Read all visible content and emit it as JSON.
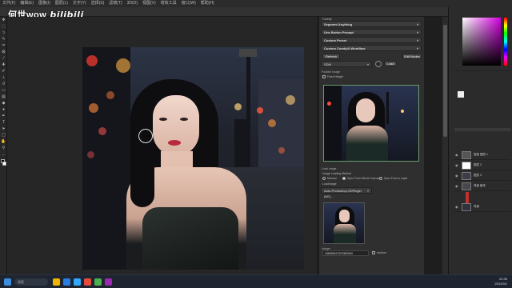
{
  "watermark": {
    "channel": "何世wow",
    "logo": "bilibili"
  },
  "menu": [
    "文件(F)",
    "编辑(E)",
    "图像(I)",
    "图层(L)",
    "文字(Y)",
    "选择(S)",
    "滤镜(T)",
    "3D(D)",
    "视图(V)",
    "增效工具",
    "窗口(W)",
    "帮助(H)"
  ],
  "panel": {
    "title": "Comfy",
    "dropdowns": [
      "Segment Anything",
      "One Button Prompt",
      "Custom Preset",
      "Custom ComfyUI Workflow"
    ],
    "buttons": {
      "refresh": "Refresh",
      "edit_nodes": "Edit Nodes",
      "load": "Load"
    },
    "model_select": "SDM",
    "section_input": "Positive Image",
    "fixed_height": "Fixed Height",
    "section_load": "Load Image",
    "image_loading_method": "Image Loading Method",
    "radio_options": [
      "Manual",
      "Sync From Whole Canvas",
      "Sync From a Layer"
    ],
    "loadimage_label": "LoadImage",
    "layer_select": "Auto-Photoshop-SDPlugin (NE)...",
    "section_integer": "Integer",
    "seed_value": "438956047297800000",
    "random_label": "random"
  },
  "layers": [
    "智能 图层 1",
    "图层 2",
    "图层 3",
    "背景 副本",
    "背景"
  ],
  "taskbar": {
    "search": "搜索",
    "time": "22:35",
    "date": "2024/3/1"
  },
  "colors": {
    "accent": "#d400e0",
    "selection": "#4d7a4d",
    "highlight_layer": "#c23030"
  }
}
